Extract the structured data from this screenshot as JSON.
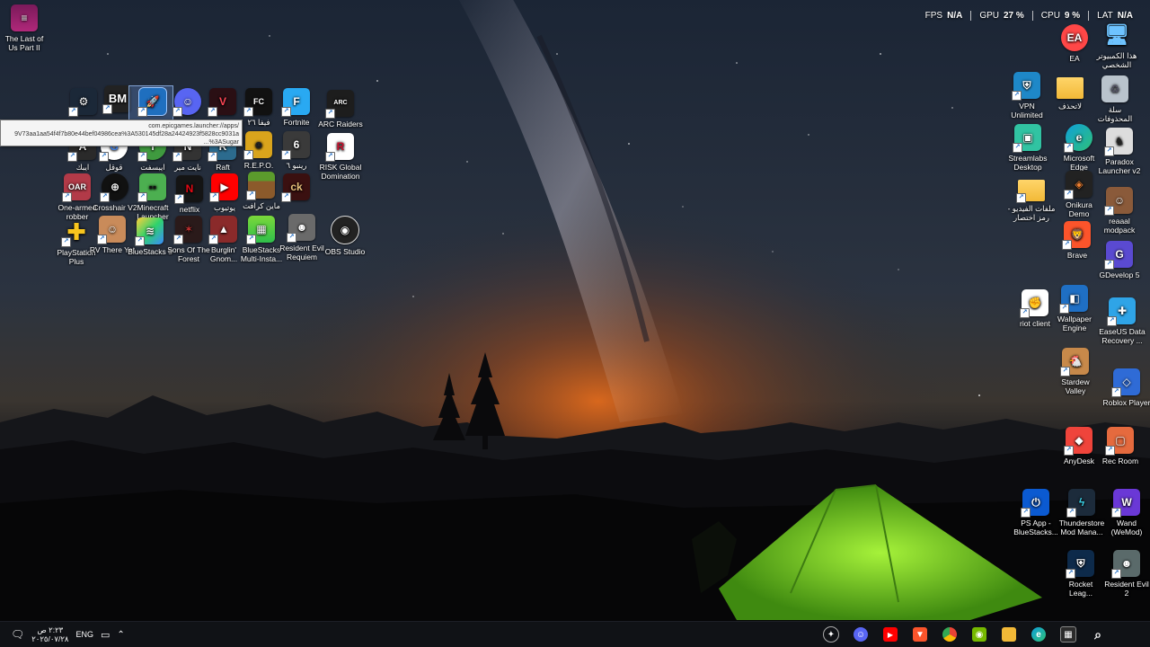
{
  "perf_overlay": [
    {
      "label": "FPS",
      "value": "N/A"
    },
    {
      "label": "GPU",
      "value": "27 %"
    },
    {
      "label": "CPU",
      "value": "9 %"
    },
    {
      "label": "LAT",
      "value": "N/A"
    }
  ],
  "tooltip": {
    "line1": "com.epicgames.launcher://apps/",
    "line2": "9V73aa1aa54f4f7b80e44bef04986cea%3A530145df28a24424923f5828cc9031a",
    "line3": "...%3ASugar"
  },
  "icons": {
    "last_of_us": "The Last of Us Part II",
    "steam": "",
    "bm": "",
    "rocket_top": "",
    "discord_top": "",
    "valorant": "",
    "fifa": "فيفا ٢٦",
    "fortnite": "Fortnite",
    "arc": "ARC Raiders",
    "apex": "ايبك",
    "google": "قوقل",
    "ibisfit": "ايبسفت",
    "nightmare": "نايت مير",
    "raft": "Raft",
    "repo": "R.E.P.O.",
    "rainbow": "رينبو ٦",
    "risk": "RISK Global Domination",
    "onearmed": "One-armed robber",
    "crosshair": "Crosshair V2",
    "minecraft_launcher": "Minecraft Launcher",
    "netflix": "netflix",
    "youtube": "يوتيوب",
    "minecraft": "ماين كرافت",
    "ck": "",
    "psplus": "PlayStation Plus",
    "rv": "RV There Yet",
    "bluestacks5": "BlueStacks 5",
    "sonsforest": "Sons Of The Forest",
    "burglin": "Burglin' Gnom...",
    "bs_multi": "BlueStacks Multi-Insta...",
    "re_requiem": "Resident Evil Requiem",
    "obs": "OBS Studio",
    "ea": "EA",
    "this_pc": "هذا الكمبيوتر الشخصي",
    "vpn": "VPN Unlimited",
    "ladelete": "لاتحذف",
    "recycle": "سلة المحذوفات",
    "streamlabs": "Streamlabs Desktop",
    "edge": "Microsoft Edge",
    "paradox": "Paradox Launcher v2",
    "video_files": "ملفات الفيديو - رمز اختصار",
    "onikura": "Onikura Demo",
    "reaaal": "reaaal modpack",
    "brave": "Brave",
    "gdevelop": "GDevelop 5",
    "riot": "riot client",
    "wallpaper_engine": "Wallpaper Engine",
    "easeus": "EaseUS Data Recovery ...",
    "stardew": "Stardew Valley",
    "roblox": "Roblox Player",
    "anydesk": "AnyDesk",
    "recroom": "Rec Room",
    "psapp": "PS App - BlueStacks...",
    "thunderstore": "Thunderstore Mod Mana...",
    "wand": "Wand (WeMod)",
    "rocket_league": "Rocket Leag...",
    "re2": "Resident Evil 2"
  },
  "taskbar": {
    "time": "٢:٢٣ ص",
    "date": "٢٠٢٥/٠٧/٢٨",
    "lang": "ENG",
    "apps": [
      "ai-assistant-icon",
      "discord-icon",
      "youtube-icon",
      "brave-icon",
      "chrome-icon",
      "nvidia-icon",
      "file-explorer-icon",
      "edge-icon",
      "microsoft-store-icon",
      "search-icon",
      "start-icon"
    ]
  },
  "colors": {
    "taskbar_bg": "#101216",
    "tent": "#7bd12e"
  }
}
